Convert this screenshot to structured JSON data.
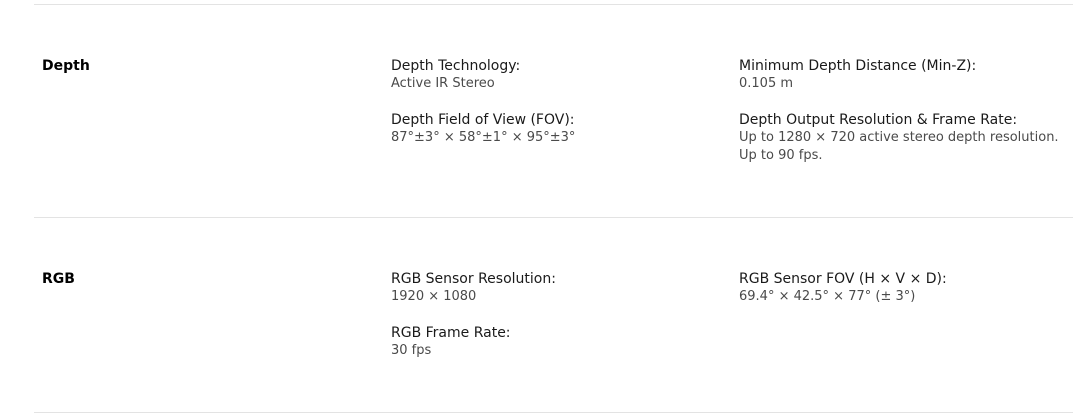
{
  "sections": [
    {
      "title": "Depth",
      "col_a": [
        {
          "label": "Depth Technology:",
          "values": [
            "Active IR Stereo"
          ]
        },
        {
          "label": "Depth Field of View (FOV):",
          "values": [
            "87°±3° × 58°±1° × 95°±3°"
          ]
        }
      ],
      "col_b": [
        {
          "label": "Minimum Depth Distance (Min-Z):",
          "values": [
            "0.105 m"
          ]
        },
        {
          "label": "Depth Output Resolution & Frame Rate:",
          "values": [
            "Up to 1280 × 720 active stereo depth resolution.",
            "Up to 90 fps."
          ]
        }
      ]
    },
    {
      "title": "RGB",
      "col_a": [
        {
          "label": "RGB Sensor Resolution:",
          "values": [
            "1920 × 1080"
          ]
        },
        {
          "label": "RGB Frame Rate:",
          "values": [
            "30 fps"
          ]
        }
      ],
      "col_b": [
        {
          "label": "RGB Sensor FOV (H × V × D):",
          "values": [
            "69.4° × 42.5° × 77° (± 3°)"
          ]
        }
      ]
    }
  ]
}
